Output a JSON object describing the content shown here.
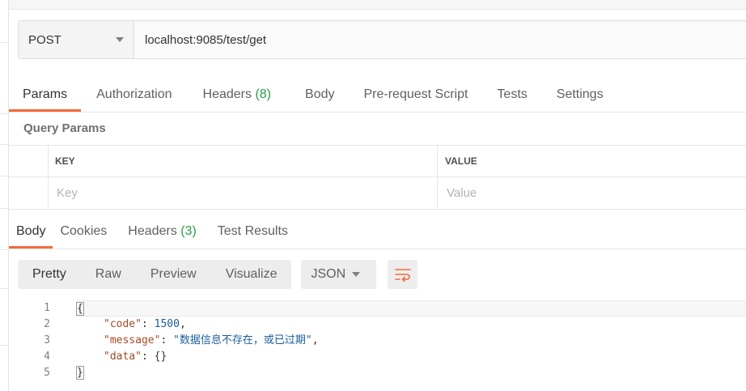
{
  "request": {
    "method": "POST",
    "url": "localhost:9085/test/get",
    "tabs": [
      {
        "label": "Params",
        "count": ""
      },
      {
        "label": "Authorization",
        "count": ""
      },
      {
        "label": "Headers",
        "count": "(8)"
      },
      {
        "label": "Body",
        "count": ""
      },
      {
        "label": "Pre-request Script",
        "count": ""
      },
      {
        "label": "Tests",
        "count": ""
      },
      {
        "label": "Settings",
        "count": ""
      }
    ],
    "active_tab": "Params"
  },
  "query_params": {
    "title": "Query Params",
    "key_header": "KEY",
    "value_header": "VALUE",
    "key_placeholder": "Key",
    "value_placeholder": "Value"
  },
  "response": {
    "tabs": [
      {
        "label": "Body",
        "count": ""
      },
      {
        "label": "Cookies",
        "count": ""
      },
      {
        "label": "Headers",
        "count": "(3)"
      },
      {
        "label": "Test Results",
        "count": ""
      }
    ],
    "active_tab": "Body",
    "view_modes": [
      "Pretty",
      "Raw",
      "Preview",
      "Visualize"
    ],
    "active_view": "Pretty",
    "format": "JSON",
    "lines": [
      {
        "num": "1",
        "text": "{"
      },
      {
        "num": "2",
        "key": "\"code\"",
        "sep": ": ",
        "value": "1500",
        "tail": ","
      },
      {
        "num": "3",
        "key": "\"message\"",
        "sep": ": ",
        "value": "\"数据信息不存在，或已过期\"",
        "tail": ","
      },
      {
        "num": "4",
        "key": "\"data\"",
        "sep": ": ",
        "value": "{}",
        "tail": ""
      },
      {
        "num": "5",
        "text": "}"
      }
    ]
  },
  "colors": {
    "accent": "#f26b3a",
    "count_green": "#27a048",
    "json_key": "#a24b25",
    "json_value": "#1c5e9e"
  }
}
